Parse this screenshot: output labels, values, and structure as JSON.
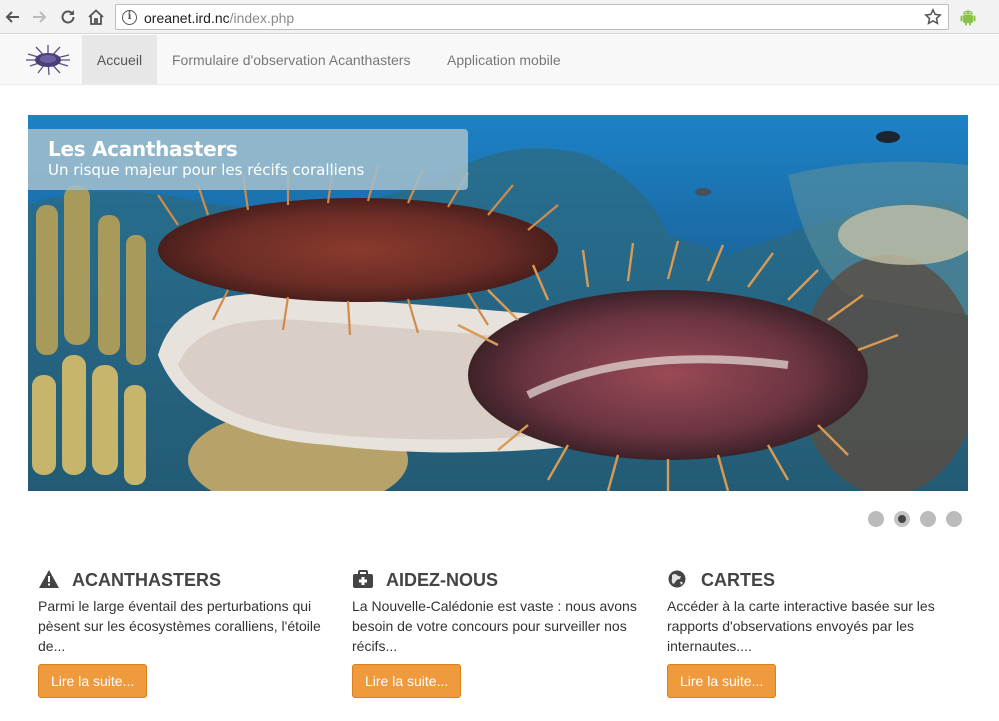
{
  "browser": {
    "url_host": "oreanet.ird.nc",
    "url_path": "/index.php",
    "icons": [
      "back-icon",
      "forward-icon",
      "reload-icon",
      "home-icon",
      "info-icon",
      "star-icon",
      "android-icon"
    ]
  },
  "nav": {
    "brand_icon": "starfish-icon",
    "items": [
      {
        "label": "Accueil",
        "active": true
      },
      {
        "label": "Formulaire d'observation Acanthasters",
        "active": false
      },
      {
        "label": "Application mobile",
        "active": false
      }
    ]
  },
  "carousel": {
    "title": "Les Acanthasters",
    "subtitle": "Un risque majeur pour les récifs coralliens",
    "slide_count": 4,
    "active_slide": 2
  },
  "features": [
    {
      "icon": "warning-icon",
      "title": "ACANTHASTERS",
      "text": "Parmi le large éventail des perturbations qui pèsent sur les écosystèmes coralliens, l'étoile de...",
      "button": "Lire la suite..."
    },
    {
      "icon": "medkit-icon",
      "title": "AIDEZ-NOUS",
      "text": "La Nouvelle-Calédonie est vaste : nous avons besoin de votre concours pour surveiller nos récifs...",
      "button": "Lire la suite..."
    },
    {
      "icon": "globe-icon",
      "title": "CARTES",
      "text": "Accéder à la carte interactive basée sur les rapports d'observations envoyés par les internautes....",
      "button": "Lire la suite..."
    }
  ],
  "colors": {
    "accent_button": "#ef9a3d",
    "navbar_bg": "#f8f8f8",
    "caption_bg": "#a0becd"
  }
}
